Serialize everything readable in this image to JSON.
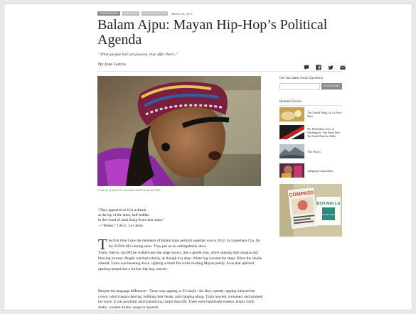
{
  "article": {
    "tags": [
      "COMMENTARY",
      "AMERICAS",
      "ARTS & CULTURE"
    ],
    "date": "March 20, 2017",
    "title": "Balam Ajpu: Mayan Hip-Hop’s Political Agenda",
    "dek": "“When people feel our passion, they offer theirs.”",
    "byline": "By Jose Garcia",
    "caption": "Courtesy of Victoria Castañeda and Gerardo del Valle",
    "poem": [
      "“They appeared as if in a dream",
      "at the top of the dune, half-hidden",
      "in the cloud of sand rising from their steps.”",
      "—“Desert,” J.M.G. Le Clézio"
    ],
    "p1_dropcap": "T",
    "p1_rest": "he first time I saw the members of Balam Ajpu perform together was in 2012, in Guatemala City, for the ZONA M’s closing show. They put on an unforgettable show.",
    "p2": "Tzutu, Nativo, and MChe walked onto the stage slowly, like a gentle mist, while shaking their sonajas and blowing incense. People watched silently, as though in a daze. White fog covered the steps. When the smoke cleared, Tzutu was kneeling down, lighting a small fire while reciting Mayan poetry. Soon that spiritual opening turned into a furious hip-hop concert.",
    "p3": "Despite the language difference—Tzutu was rapping in Tz’utujil—his fiery, speedy rapping infected the crowd, which began dancing, bobbing their heads, and clapping along. Tzutu howled, screamed, and strained his voice. It was powerful and hypnotizing; larger than life. There were handmade shakers, empty turtle shells, wooden drums, songs in Spanish."
  },
  "share_icons": [
    "comment-icon",
    "facebook-icon",
    "twitter-icon",
    "email-icon"
  ],
  "sidebar": {
    "latest_prefix": "Get the latest from ",
    "latest_brand": "Guernica",
    "email_placeholder": "",
    "subscribe_label": "SUBSCRIBE",
    "related_heading": "Related Stories",
    "related": [
      "The Naked Ninja, or La Perle Marc",
      "Mr. McKibben Goes to Washington: The Final Anti-Tar Sands Pipeline Rally",
      "Two Rivers",
      "Adopting Guatemalan"
    ],
    "ad": {
      "magazine": "COMPASS",
      "brand": "BOXWALLA",
      "tagline": "Read the World"
    }
  },
  "colors": {
    "tag_gray": "#8a8a8a",
    "ad_red": "#d23a2f",
    "ad_teal": "#2f8a7e"
  }
}
